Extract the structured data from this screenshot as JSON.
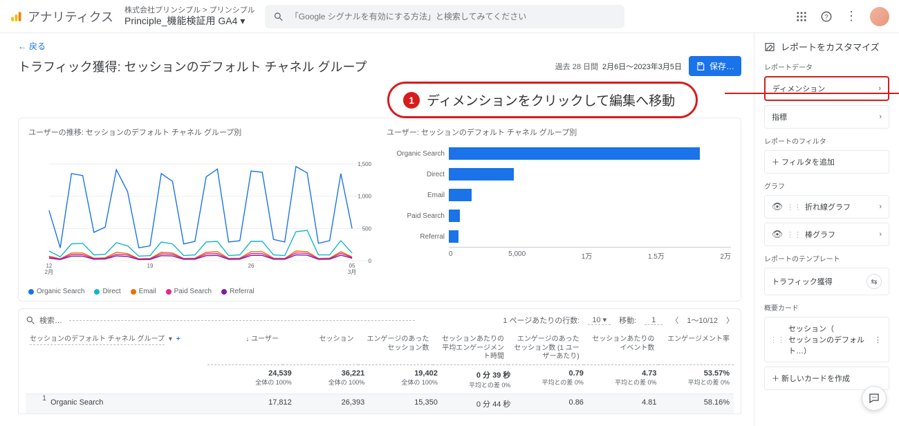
{
  "header": {
    "product": "アナリティクス",
    "breadcrumb": "株式会社プリンシプル > プリンシプル",
    "property": "Principle_機能検証用 GA4",
    "search_placeholder": "「Google シグナルを有効にする方法」と検索してみてください"
  },
  "page": {
    "back": "戻る",
    "title": "トラフィック獲得: セッションのデフォルト チャネル グループ",
    "date_label": "過去 28 日間",
    "date_range": "2月6日～2023年3月5日",
    "save": "保存…"
  },
  "annotation": {
    "number": "1",
    "text": "ディメンションをクリックして編集へ移動"
  },
  "chart_data": [
    {
      "type": "line",
      "title": "ユーザーの推移: セッションのデフォルト チャネル グループ別",
      "xlabel": "",
      "ylabel": "",
      "ylim": [
        0,
        1500
      ],
      "yticks": [
        0,
        500,
        1000,
        1500
      ],
      "x": [
        "12\n2月",
        "19",
        "26",
        "05\n3月"
      ],
      "series": [
        {
          "name": "Organic Search",
          "color": "#1a73e8",
          "values": [
            780,
            200,
            1350,
            1320,
            440,
            520,
            1410,
            1070,
            200,
            230,
            1350,
            1230,
            260,
            300,
            1300,
            1420,
            290,
            310,
            1390,
            1370,
            330,
            290,
            1460,
            1360,
            270,
            310,
            1350,
            500
          ]
        },
        {
          "name": "Direct",
          "color": "#12b5cb",
          "values": [
            150,
            60,
            260,
            270,
            90,
            100,
            280,
            230,
            70,
            80,
            290,
            260,
            80,
            90,
            290,
            300,
            80,
            90,
            300,
            300,
            90,
            80,
            450,
            470,
            90,
            90,
            310,
            120
          ]
        },
        {
          "name": "Email",
          "color": "#e8710a",
          "values": [
            70,
            30,
            120,
            120,
            40,
            45,
            130,
            110,
            30,
            35,
            130,
            120,
            35,
            40,
            130,
            140,
            35,
            40,
            140,
            140,
            40,
            35,
            150,
            140,
            35,
            40,
            140,
            60
          ]
        },
        {
          "name": "Paid Search",
          "color": "#e52592",
          "values": [
            55,
            25,
            95,
            95,
            32,
            36,
            100,
            90,
            25,
            28,
            105,
            100,
            30,
            32,
            105,
            110,
            30,
            32,
            110,
            110,
            32,
            30,
            120,
            115,
            30,
            32,
            115,
            50
          ]
        },
        {
          "name": "Referral",
          "color": "#7b1fa2",
          "values": [
            40,
            18,
            70,
            70,
            24,
            26,
            75,
            65,
            18,
            20,
            78,
            74,
            22,
            24,
            78,
            82,
            22,
            24,
            82,
            82,
            24,
            22,
            90,
            86,
            22,
            24,
            86,
            38
          ]
        }
      ]
    },
    {
      "type": "bar",
      "title": "ユーザー: セッションのデフォルト チャネル グループ別",
      "xlabel": "",
      "ylabel": "",
      "xlim": [
        0,
        20000
      ],
      "xticks_labels": [
        "0",
        "5,000",
        "1万",
        "1.5万",
        "2万"
      ],
      "categories": [
        "Organic Search",
        "Direct",
        "Email",
        "Paid Search",
        "Referral"
      ],
      "values": [
        17800,
        4600,
        1600,
        800,
        700
      ],
      "color": "#1a73e8"
    }
  ],
  "table": {
    "search_label": "検索…",
    "rows_per_page_label": "1 ページあたりの行数:",
    "rows_per_page": "10",
    "goto_label": "移動:",
    "goto": "1",
    "range": "1～10/12",
    "dimension_header": "セッションのデフォルト チャネル グループ",
    "columns": [
      "ユーザー",
      "セッション",
      "エンゲージのあったセッション数",
      "セッションあたりの平均エンゲージメント時間",
      "エンゲージのあったセッション数 (1 ユーザーあたり)",
      "セッションあたりのイベント数",
      "エンゲージメント率"
    ],
    "totals": {
      "values": [
        "24,539",
        "36,221",
        "19,402",
        "0 分 39 秒",
        "0.79",
        "4.73",
        "53.57%"
      ],
      "sub": [
        "全体の 100%",
        "全体の 100%",
        "全体の 100%",
        "平均との差 0%",
        "平均との差 0%",
        "平均との差 0%",
        "平均との差 0%"
      ]
    },
    "rows": [
      {
        "idx": "1",
        "dim": "Organic Search",
        "values": [
          "17,812",
          "26,393",
          "15,350",
          "0 分 44 秒",
          "0.86",
          "4.81",
          "58.16%"
        ]
      }
    ]
  },
  "sidebar": {
    "title": "レポートをカスタマイズ",
    "data_label": "レポートデータ",
    "dimension": "ディメンション",
    "metric": "指標",
    "filter_label": "レポートのフィルタ",
    "add_filter": "＋ フィルタを追加",
    "chart_label": "グラフ",
    "line_chart": "折れ線グラフ",
    "bar_chart": "棒グラフ",
    "template_label": "レポートのテンプレート",
    "template": "トラフィック獲得",
    "card_label": "概要カード",
    "card_title": "セッション（\nセッションのデフォルト…）",
    "add_card": "＋ 新しいカードを作成"
  }
}
